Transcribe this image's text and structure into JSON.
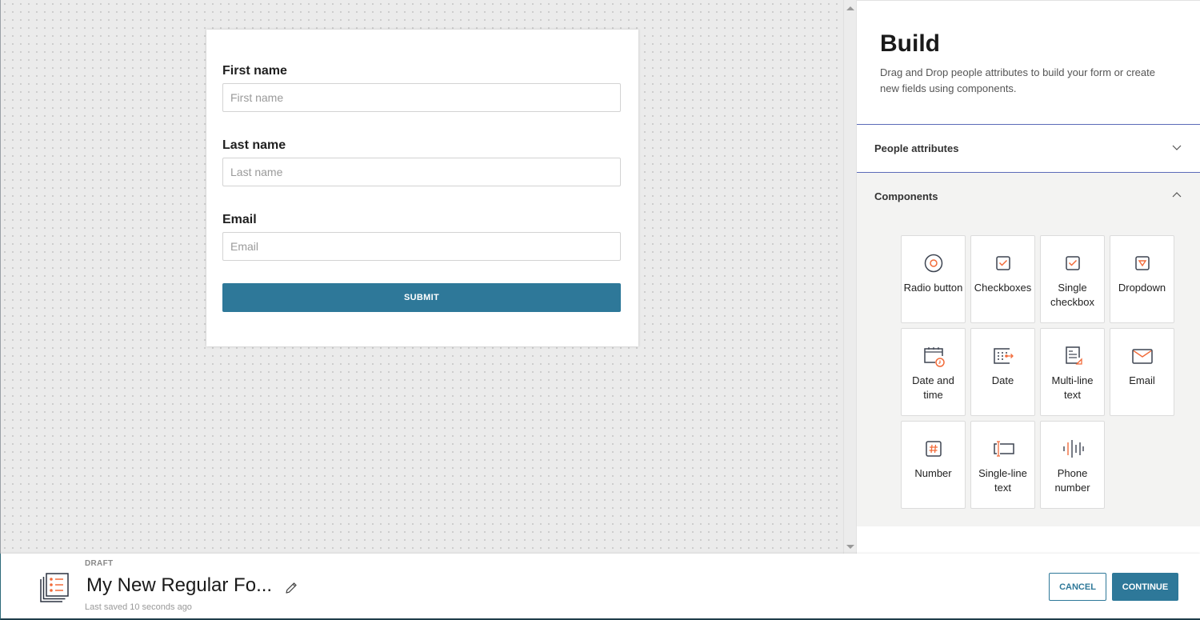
{
  "form": {
    "fields": [
      {
        "label": "First name",
        "placeholder": "First name",
        "value": ""
      },
      {
        "label": "Last name",
        "placeholder": "Last name",
        "value": ""
      },
      {
        "label": "Email",
        "placeholder": "Email",
        "value": ""
      }
    ],
    "submit_label": "SUBMIT"
  },
  "panel": {
    "title": "Build",
    "description": "Drag and Drop people attributes to build your form or create new fields using components.",
    "sections": [
      {
        "label": "People attributes",
        "expanded": false,
        "icon": "chevron-down-icon"
      },
      {
        "label": "Components",
        "expanded": true,
        "icon": "chevron-up-icon"
      }
    ],
    "components": [
      {
        "label": "Radio button",
        "icon": "radio-button-icon"
      },
      {
        "label": "Checkboxes",
        "icon": "checkboxes-icon"
      },
      {
        "label": "Single checkbox",
        "icon": "single-checkbox-icon"
      },
      {
        "label": "Dropdown",
        "icon": "dropdown-icon"
      },
      {
        "label": "Date and time",
        "icon": "date-time-icon"
      },
      {
        "label": "Date",
        "icon": "date-icon"
      },
      {
        "label": "Multi-line text",
        "icon": "multi-line-text-icon"
      },
      {
        "label": "Email",
        "icon": "email-icon"
      },
      {
        "label": "Number",
        "icon": "number-icon"
      },
      {
        "label": "Single-line text",
        "icon": "single-line-text-icon"
      },
      {
        "label": "Phone number",
        "icon": "phone-number-icon"
      }
    ]
  },
  "footer": {
    "status": "DRAFT",
    "form_title": "My New Regular Fo...",
    "last_saved": "Last saved 10 seconds ago",
    "cancel_label": "CANCEL",
    "continue_label": "CONTINUE"
  },
  "colors": {
    "primary": "#2e7899",
    "accent_orange": "#f26b3a",
    "icon_dark": "#3d4451",
    "divider_blue": "#5b6bb8"
  }
}
